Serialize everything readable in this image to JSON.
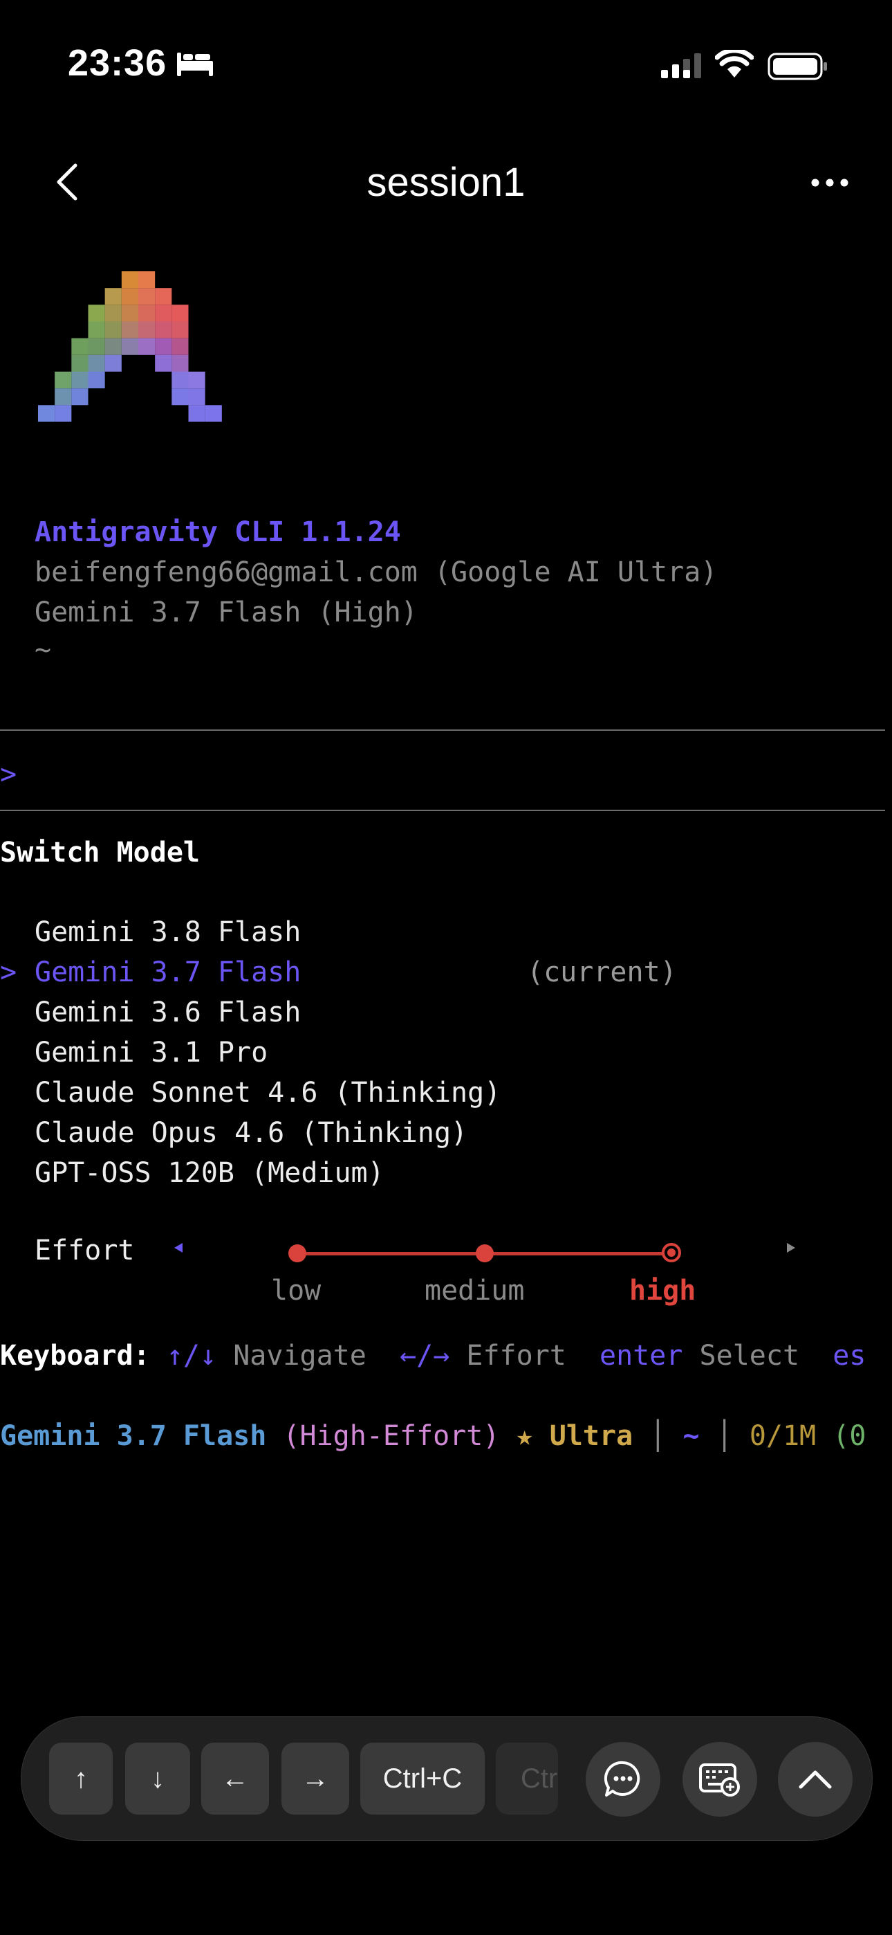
{
  "status_bar": {
    "time": "23:36"
  },
  "nav": {
    "title": "session1"
  },
  "terminal": {
    "app_name": "Antigravity CLI 1.1.24",
    "account": "beifengfeng66@gmail.com (Google AI Ultra)",
    "model_line": "Gemini 3.7 Flash (High)",
    "cwd": "~",
    "prompt": ">",
    "switch_title": "Switch Model",
    "select_caret": ">",
    "current_tag": "(current)",
    "models": [
      "Gemini 3.8 Flash",
      "Gemini 3.7 Flash",
      "Gemini 3.6 Flash",
      "Gemini 3.1 Pro",
      "Claude Sonnet 4.6 (Thinking)",
      "Claude Opus 4.6 (Thinking)",
      "GPT-OSS 120B (Medium)"
    ],
    "selected_model_index": 1,
    "effort": {
      "label": "Effort",
      "options": [
        "low",
        "medium",
        "high"
      ],
      "selected": "high"
    },
    "keyboard_help": {
      "label": "Keyboard:",
      "items": [
        {
          "key": "↑/↓",
          "desc": "Navigate"
        },
        {
          "key": "←/→",
          "desc": "Effort"
        },
        {
          "key": "enter",
          "desc": "Select"
        },
        {
          "key": "es",
          "desc": ""
        }
      ]
    },
    "statusline": {
      "model": "Gemini 3.7 Flash",
      "effort": "(High-Effort)",
      "plan": "★ Ultra",
      "sep": "│",
      "cwd": "~",
      "tokens": "0/1M",
      "extra": "(0"
    }
  },
  "toolbar": {
    "keys": [
      "↑",
      "↓",
      "←",
      "→",
      "Ctrl+C",
      "Ctr"
    ]
  },
  "colors": {
    "accent": "#6b56f5",
    "effort_red": "#d9433b",
    "statusline_model": "#5a9bd5",
    "statusline_plan": "#d0a94c"
  }
}
